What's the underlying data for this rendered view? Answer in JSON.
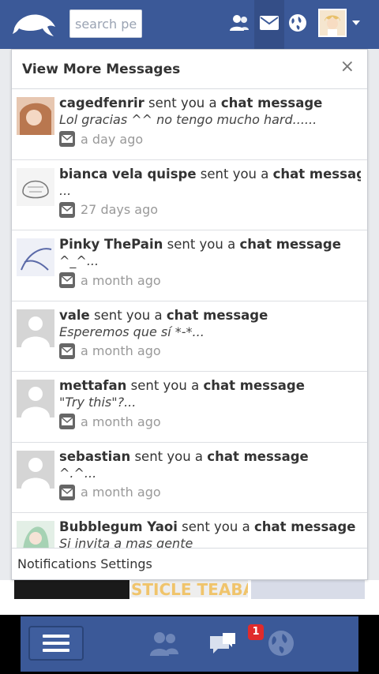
{
  "topbar": {
    "search_placeholder": "search pe"
  },
  "panel": {
    "title": "View More Messages",
    "close_label": "×",
    "footer_link": "Notifications Settings",
    "sent_text": "sent you a",
    "chat_text": "chat message",
    "items": [
      {
        "name": "cagedfenrir",
        "snippet": "Lol gracias ^^ no tengo mucho hard......",
        "time": "a day ago",
        "avatar_color": "#c9a58e"
      },
      {
        "name": "bianca vela quispe",
        "snippet": "...",
        "time": "27 days ago",
        "avatar_color": "#efefef"
      },
      {
        "name": "Pinky ThePain",
        "snippet": "^_^...",
        "time": "a month ago",
        "avatar_color": "#dfe3ef"
      },
      {
        "name": "vale",
        "snippet": "Esperemos que sí *-*...",
        "time": "a month ago",
        "avatar_color": "#d5d5d5"
      },
      {
        "name": "mettafan",
        "snippet": "\"Try this\"?...",
        "time": "a month ago",
        "avatar_color": "#d5d5d5"
      },
      {
        "name": "sebastian",
        "snippet": "^.^...",
        "time": "a month ago",
        "avatar_color": "#d5d5d5"
      },
      {
        "name": "Bubblegum Yaoi",
        "snippet": "Si invita a mas gente",
        "time": "",
        "avatar_color": "#cfe3d6"
      }
    ]
  },
  "peek": {
    "banner_text": "STICLE TEABA"
  },
  "bottombar": {
    "notification_count": "1"
  },
  "colors": {
    "brand": "#3b5998",
    "badge": "#e02b2b"
  }
}
